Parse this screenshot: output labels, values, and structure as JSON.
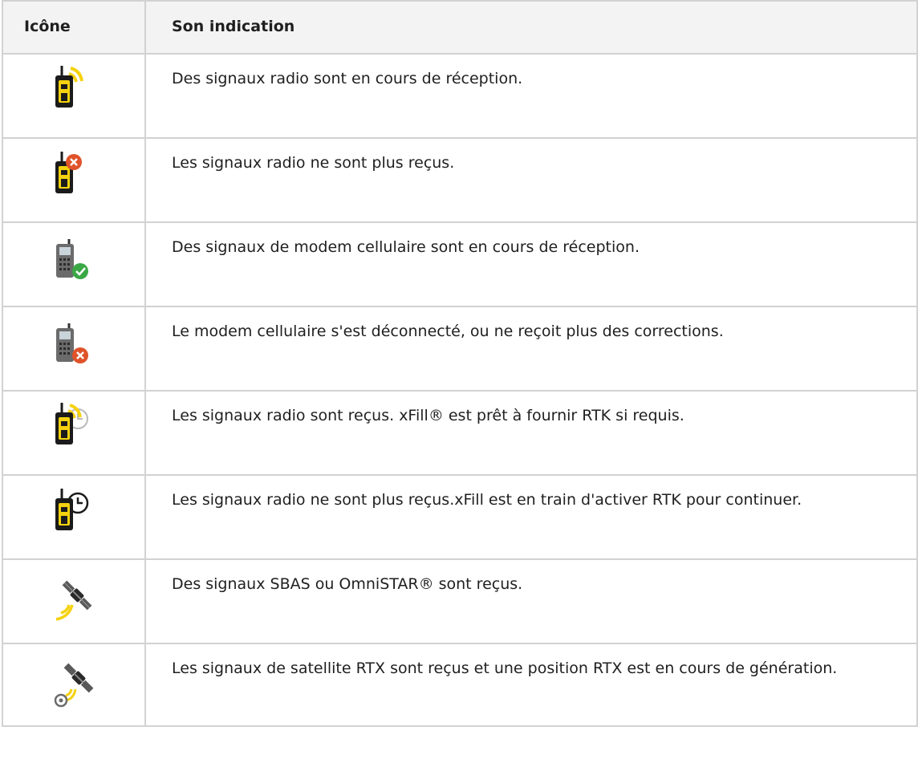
{
  "table": {
    "headers": {
      "icon": "Icône",
      "indication": "Son indication"
    },
    "rows": [
      {
        "icon": "radio-receiving-icon",
        "text": "Des signaux radio sont en cours de réception."
      },
      {
        "icon": "radio-lost-icon",
        "text": "Les signaux radio ne sont plus reçus."
      },
      {
        "icon": "cellular-modem-receiving-icon",
        "text": "Des signaux de modem cellulaire sont en cours de réception."
      },
      {
        "icon": "cellular-modem-disconnected-icon",
        "text": "Le modem cellulaire s'est déconnecté, ou ne reçoit plus des corrections."
      },
      {
        "icon": "radio-xfill-ready-icon",
        "text": "Les signaux radio sont reçus. xFill® est prêt à fournir RTK si requis."
      },
      {
        "icon": "radio-xfill-active-icon",
        "text": "Les signaux radio ne sont plus reçus.xFill est en train d'activer RTK pour continuer."
      },
      {
        "icon": "sbas-omnistar-satellite-icon",
        "text": "Des signaux SBAS ou OmniSTAR® sont reçus."
      },
      {
        "icon": "rtx-satellite-icon",
        "text": "Les signaux de satellite RTX sont reçus et une position RTX est en cours de génération."
      }
    ]
  },
  "colors": {
    "radio_body": "#1b1b1b",
    "radio_yellow": "#f5d20f",
    "error_red": "#e0532a",
    "ok_green": "#3aa845",
    "phone_gray": "#6b6b6b",
    "border": "#d2d2d2",
    "header_bg": "#f3f3f3"
  }
}
